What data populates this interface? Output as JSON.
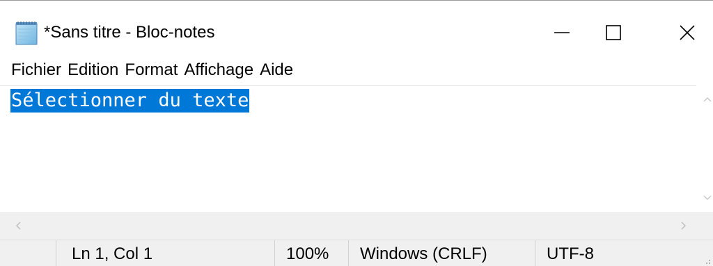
{
  "window": {
    "title": "*Sans titre - Bloc-notes",
    "app_icon": "notepad-icon"
  },
  "caption_buttons": {
    "minimize_icon": "minimize-icon",
    "maximize_icon": "maximize-icon",
    "close_icon": "close-icon"
  },
  "menu": {
    "items": [
      {
        "label": "Fichier"
      },
      {
        "label": "Edition"
      },
      {
        "label": "Format"
      },
      {
        "label": "Affichage"
      },
      {
        "label": "Aide"
      }
    ]
  },
  "editor": {
    "text": "Sélectionner du texte",
    "text_selected": true,
    "selection_color": "#0078d7"
  },
  "statusbar": {
    "position": "Ln 1, Col 1",
    "zoom": "100%",
    "line_ending": "Windows (CRLF)",
    "encoding": "UTF-8"
  }
}
